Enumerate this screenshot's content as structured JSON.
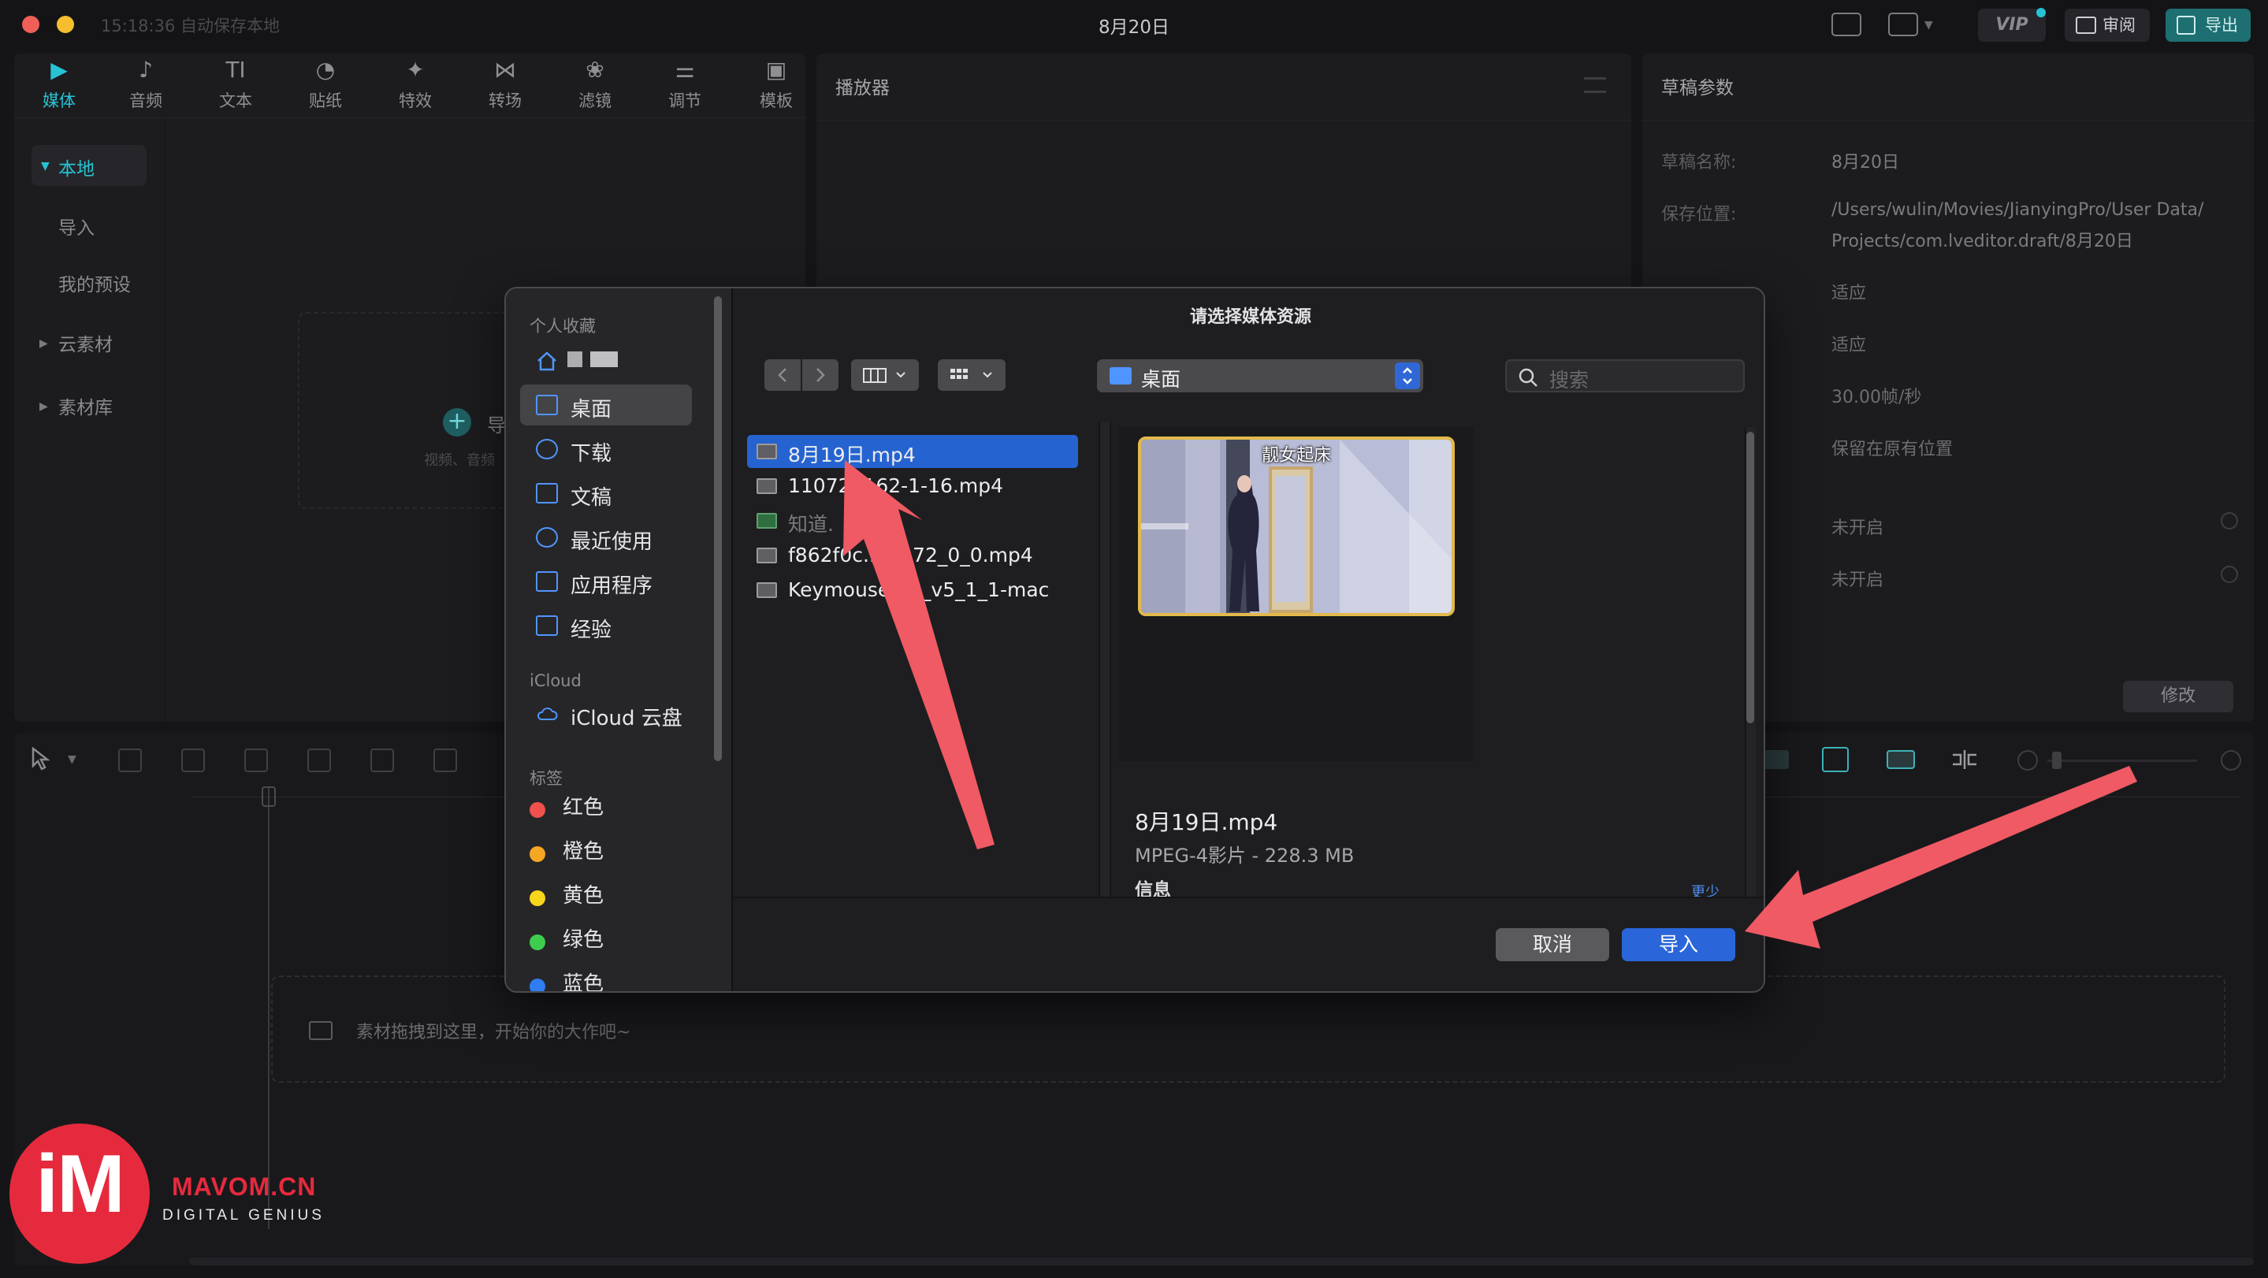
{
  "app": {
    "save_status": "15:18:36 自动保存本地",
    "title": "8月20日",
    "vip_label": "VIP",
    "review_label": "审阅",
    "export_label": "导出"
  },
  "toolbar": [
    {
      "label": "媒体",
      "icon": "media-icon",
      "active": true
    },
    {
      "label": "音频",
      "icon": "audio-icon"
    },
    {
      "label": "文本",
      "icon": "text-icon"
    },
    {
      "label": "贴纸",
      "icon": "sticker-icon"
    },
    {
      "label": "特效",
      "icon": "effects-icon"
    },
    {
      "label": "转场",
      "icon": "transition-icon"
    },
    {
      "label": "滤镜",
      "icon": "filter-icon"
    },
    {
      "label": "调节",
      "icon": "adjust-icon"
    },
    {
      "label": "模板",
      "icon": "template-icon"
    }
  ],
  "media_sidebar": {
    "local": "本地",
    "import": "导入",
    "my_presets": "我的预设",
    "cloud": "云素材",
    "library": "素材库"
  },
  "media_area": {
    "import_label": "导",
    "hint": "视频、音频"
  },
  "player": {
    "title": "播放器"
  },
  "draft": {
    "title": "草稿参数",
    "name_label": "草稿名称:",
    "name_value": "8月20日",
    "location_label": "保存位置:",
    "location_value_1": "/Users/wulin/Movies/JianyingPro/User Data/",
    "location_value_2": "Projects/com.lveditor.draft/8月20日",
    "ratio_value": "适应",
    "resolution_value": "适应",
    "fps_value": "30.00帧/秒",
    "import_mode_value": "保留在原有位置",
    "proxy_value": "未开启",
    "free_layer_value": "未开启",
    "modify_button": "修改"
  },
  "timeline": {
    "drop_hint": "素材拖拽到这里，开始你的大作吧~"
  },
  "dialog": {
    "title": "请选择媒体资源",
    "favorites_title": "个人收藏",
    "favorites": [
      {
        "label": "",
        "icon": "home-icon"
      },
      {
        "label": "桌面",
        "icon": "desktop-icon",
        "selected": true
      },
      {
        "label": "下载",
        "icon": "download-icon"
      },
      {
        "label": "文稿",
        "icon": "document-icon"
      },
      {
        "label": "最近使用",
        "icon": "recent-icon"
      },
      {
        "label": "应用程序",
        "icon": "applications-icon"
      },
      {
        "label": "经验",
        "icon": "folder-icon"
      }
    ],
    "icloud_title": "iCloud",
    "icloud_drive": "iCloud 云盘",
    "tags_title": "标签",
    "tags": [
      {
        "label": "红色",
        "color": "#f0514c"
      },
      {
        "label": "橙色",
        "color": "#f5a623"
      },
      {
        "label": "黄色",
        "color": "#f7d51d"
      },
      {
        "label": "绿色",
        "color": "#3ecc4e"
      },
      {
        "label": "蓝色",
        "color": "#2f7df0"
      }
    ],
    "location": "桌面",
    "search_placeholder": "搜索",
    "files": [
      {
        "name": "8月19日.mp4",
        "selected": true
      },
      {
        "name": "110727162-1-16.mp4"
      },
      {
        "name": "知道.",
        "dim": true
      },
      {
        "name": "f862f0c...e...72_0_0.mp4"
      },
      {
        "name": "Keymouse...p_v5_1_1-mac"
      }
    ],
    "preview": {
      "caption": "靓女起床",
      "name": "8月19日.mp4",
      "meta": "MPEG-4影片 - 228.3 MB",
      "info_label": "信息",
      "less_label": "更少"
    },
    "cancel_button": "取消",
    "import_button": "导入"
  },
  "watermark": {
    "logo_text": "iM",
    "site": "MAVOM.CN",
    "tagline": "DIGITAL GENIUS"
  },
  "colors": {
    "accent": "#27c3d4",
    "select_blue": "#2563d0",
    "arrow": "#ef5a64"
  }
}
